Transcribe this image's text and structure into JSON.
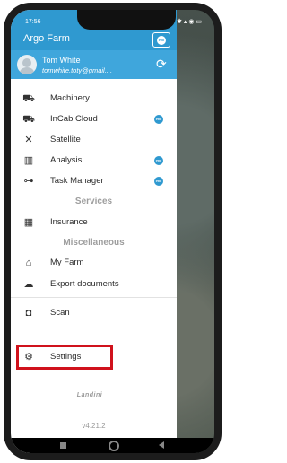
{
  "status_bar": {
    "time": "17:56",
    "left_icons": "✲ ◷ ▣ ✦",
    "right_icons": "✱ ▴ ◉ ▭"
  },
  "header": {
    "title": "Argo Farm",
    "pro_badge": "PRO"
  },
  "user": {
    "name": "Tom White",
    "email": "tomwhite.toty@gmail...."
  },
  "menu_top": [
    {
      "label": "Machinery",
      "icon": "tractor-icon",
      "pro": false
    },
    {
      "label": "InCab Cloud",
      "icon": "tractor-cloud-icon",
      "pro": true,
      "pro_text": "PRO"
    },
    {
      "label": "Satellite",
      "icon": "satellite-icon",
      "pro": false
    },
    {
      "label": "Analysis",
      "icon": "map-icon",
      "pro": true,
      "pro_text": "PRO"
    },
    {
      "label": "Task Manager",
      "icon": "route-icon",
      "pro": true,
      "pro_text": "PRO"
    }
  ],
  "sections": {
    "services": "Services",
    "misc": "Miscellaneous"
  },
  "menu_services": [
    {
      "label": "Insurance",
      "icon": "building-icon"
    }
  ],
  "menu_misc": [
    {
      "label": "My Farm",
      "icon": "farm-icon"
    },
    {
      "label": "Export documents",
      "icon": "cloud-download-icon"
    }
  ],
  "menu_bottom": [
    {
      "label": "Scan",
      "icon": "camera-icon"
    },
    {
      "label": "Settings",
      "icon": "settings-icon"
    }
  ],
  "logo_text": "Landini",
  "version": "v4.21.2",
  "colors": {
    "header": "#2f99d0",
    "highlight": "#d0121c"
  }
}
